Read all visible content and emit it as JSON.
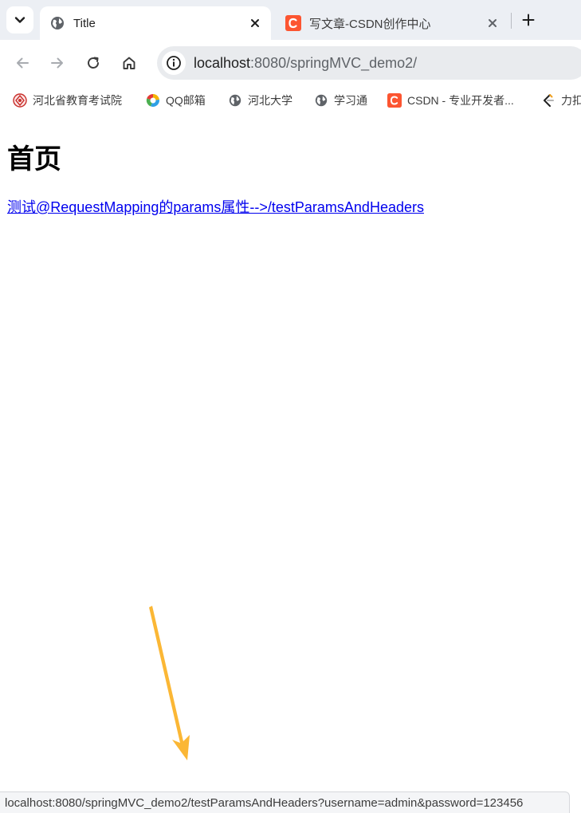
{
  "colors": {
    "tabstrip_bg": "#eceff4",
    "link": "#0000ee",
    "csdn_brand": "#fc5531",
    "arrow": "#fbb735"
  },
  "tabs": [
    {
      "title": "Title",
      "icon": "globe-icon",
      "active": true,
      "close_icon": "close-icon"
    },
    {
      "title": "写文章-CSDN创作中心",
      "icon": "csdn-logo-icon",
      "active": false,
      "close_icon": "close-icon"
    }
  ],
  "tab_search_icon": "chevron-down-icon",
  "new_tab_icon": "plus-icon",
  "toolbar": {
    "back_icon": "arrow-left-icon",
    "forward_icon": "arrow-right-icon",
    "reload_icon": "reload-icon",
    "home_icon": "home-icon",
    "site_info_icon": "info-icon"
  },
  "address_bar": {
    "host": "localhost",
    "rest": ":8080/springMVC_demo2/"
  },
  "bookmarks": [
    {
      "label": "河北省教育考试院",
      "icon": "exam-institute-icon"
    },
    {
      "label": "QQ邮箱",
      "icon": "qq-mail-icon"
    },
    {
      "label": "河北大学",
      "icon": "globe-icon"
    },
    {
      "label": "学习通",
      "icon": "globe-icon"
    },
    {
      "label": "CSDN - 专业开发者...",
      "icon": "csdn-logo-icon"
    },
    {
      "label": "力扣",
      "icon": "leetcode-icon"
    }
  ],
  "page": {
    "heading": "首页",
    "link_text": "测试@RequestMapping的params属性-->/testParamsAndHeaders"
  },
  "annotation_icon": "arrow-down-icon",
  "status_bar": {
    "url": "localhost:8080/springMVC_demo2/testParamsAndHeaders?username=admin&password=123456"
  }
}
